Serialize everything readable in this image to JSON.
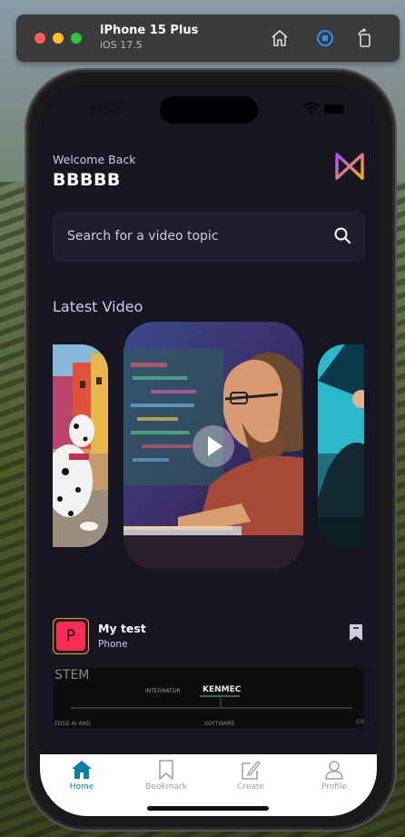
{
  "simulator": {
    "device_name": "iPhone 15 Plus",
    "os_version": "iOS 17.5",
    "icons": [
      "home-icon",
      "screenshot-icon",
      "rotate-icon"
    ]
  },
  "status_bar": {
    "time": "3:54"
  },
  "header": {
    "welcome": "Welcome Back",
    "username": "BBBBB"
  },
  "search": {
    "placeholder": "Search for a video topic"
  },
  "latest": {
    "title": "Latest Video"
  },
  "post": {
    "avatar_letter": "P",
    "title": "My test",
    "subtitle": "Phone",
    "thumb_texts": [
      "STEM",
      "INTEGRATOR",
      "KENMEC",
      "EDGE AI AND",
      "SOFTWARE",
      "CO"
    ]
  },
  "tabs": [
    {
      "label": "Home",
      "active": true
    },
    {
      "label": "Bookmark",
      "active": false
    },
    {
      "label": "Create",
      "active": false
    },
    {
      "label": "Profile",
      "active": false
    }
  ],
  "colors": {
    "background": "#161622",
    "accent": "#ff9c01",
    "tab_active": "#0a7ea4",
    "search_bg": "#1e1e2d"
  }
}
